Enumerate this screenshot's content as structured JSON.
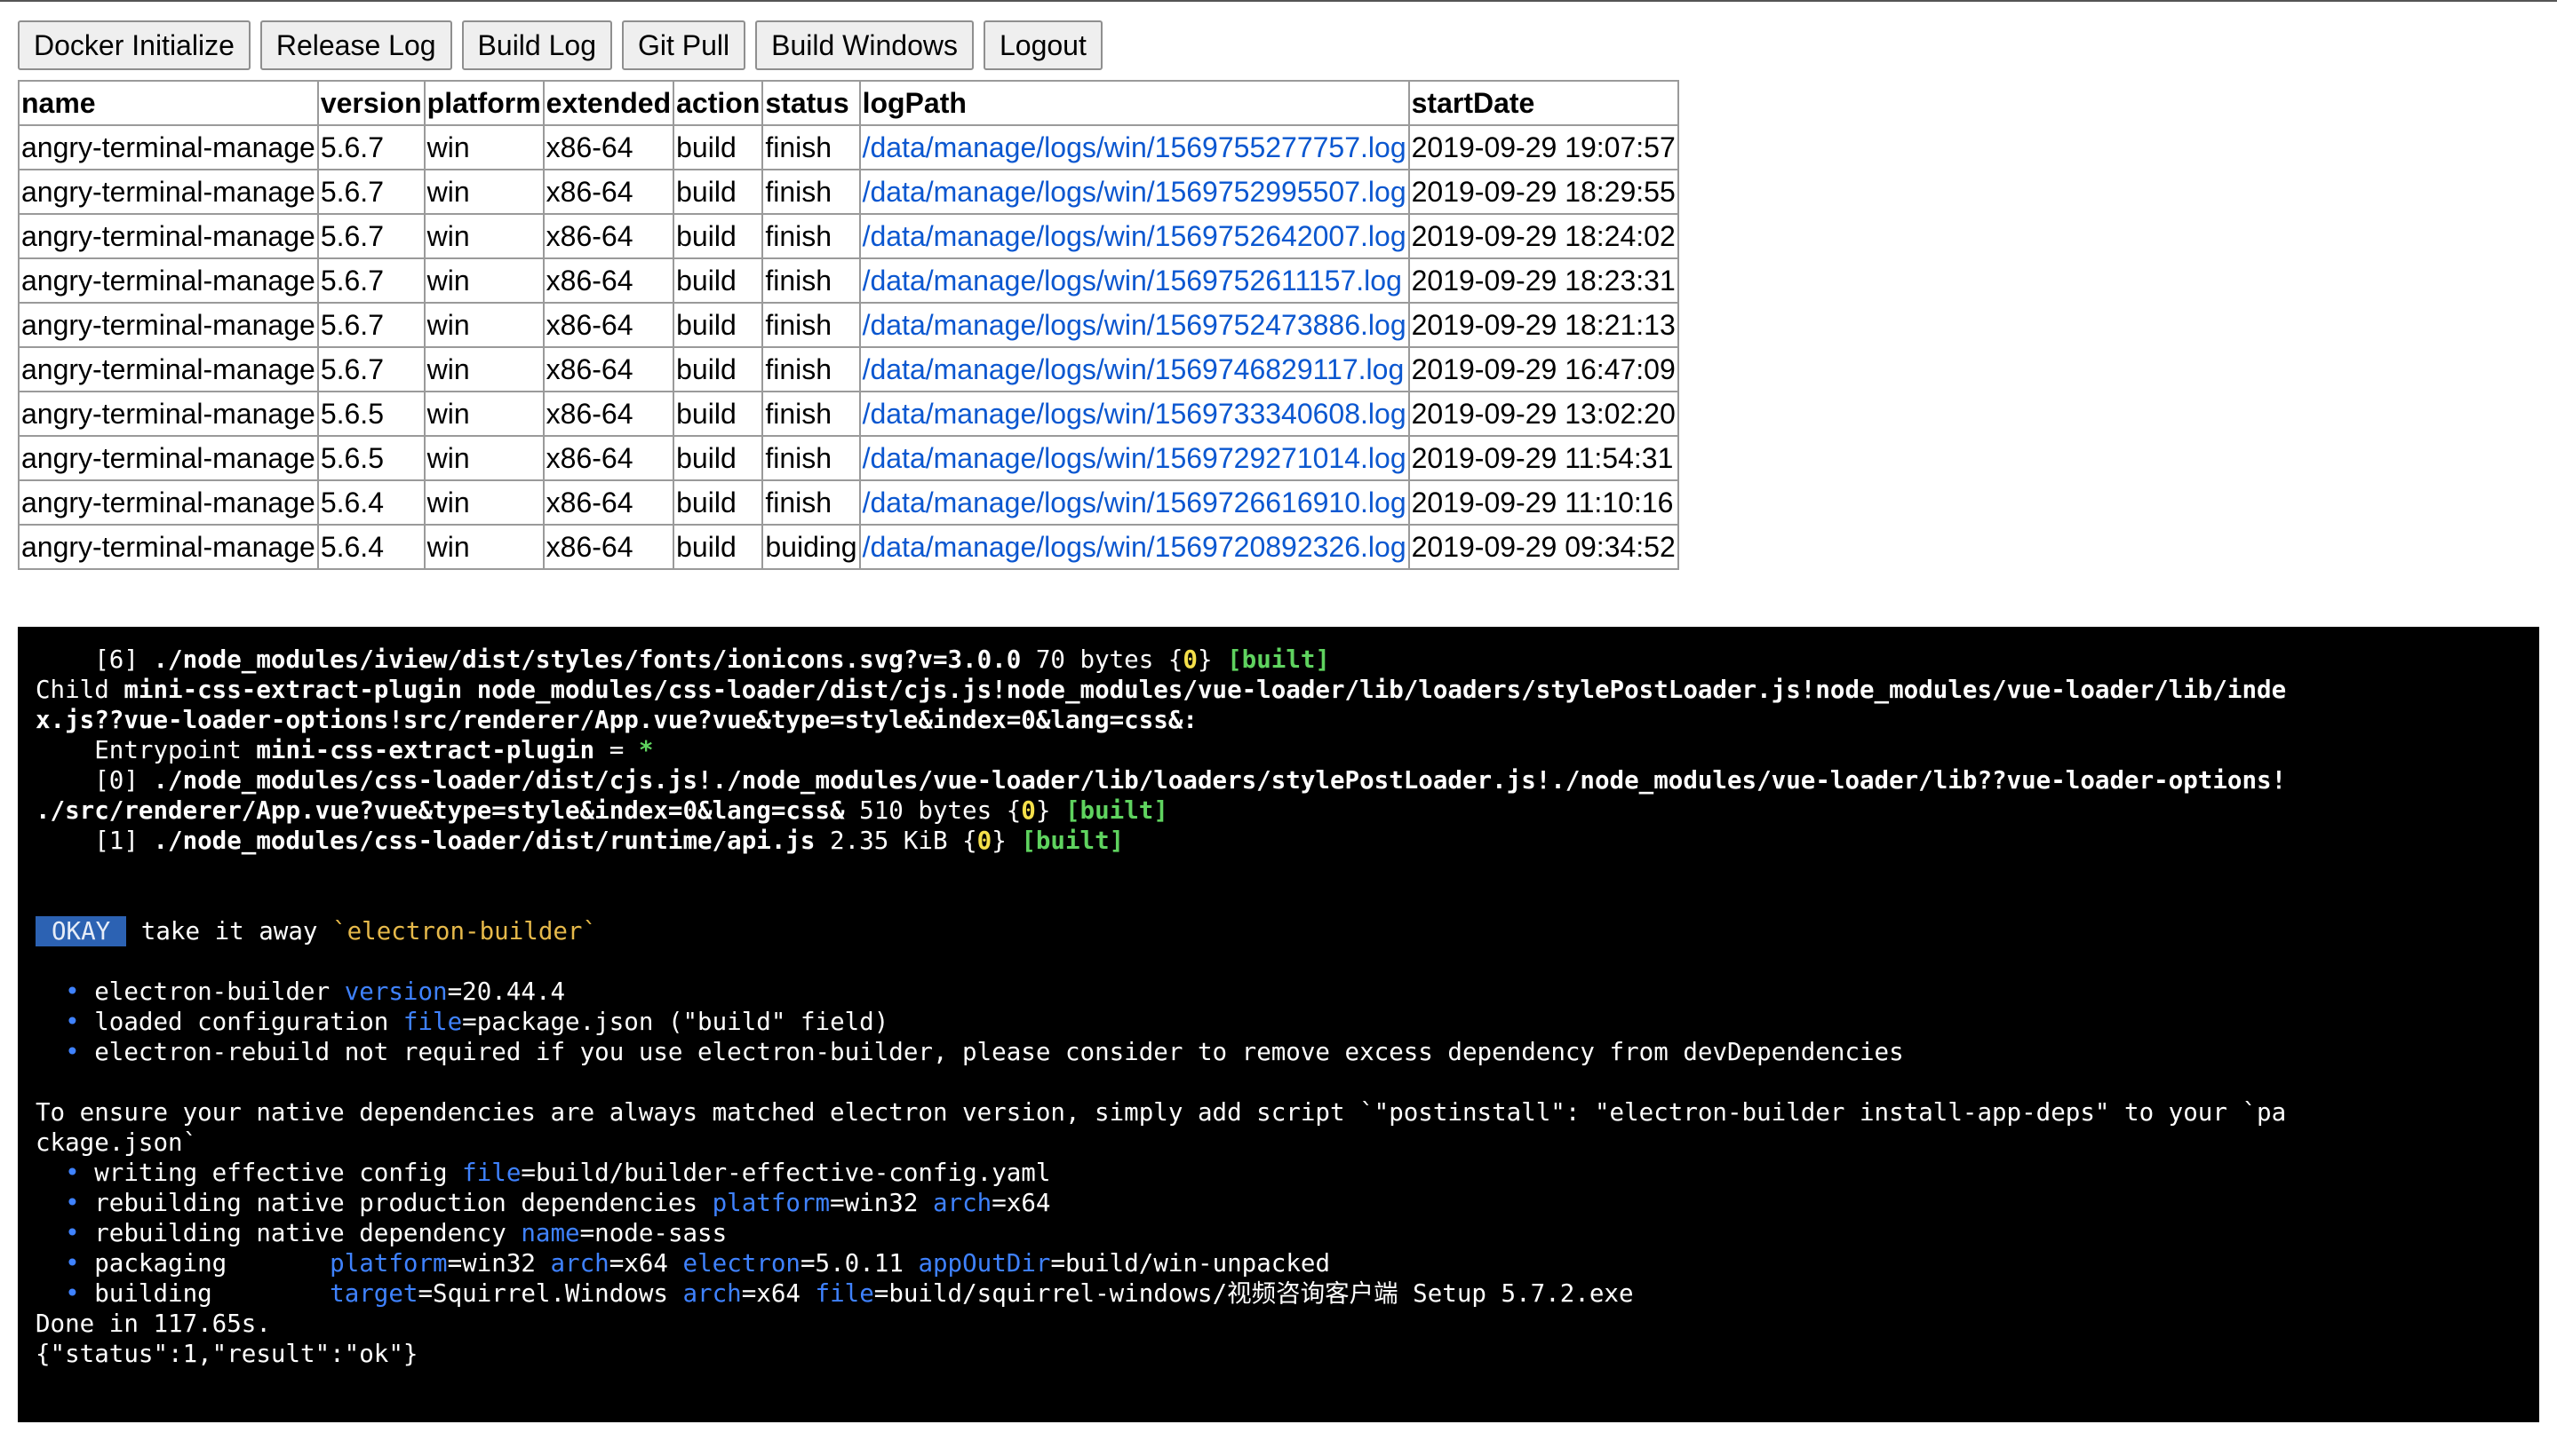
{
  "toolbar": {
    "buttons": [
      {
        "label": "Docker Initialize"
      },
      {
        "label": "Release Log"
      },
      {
        "label": "Build Log"
      },
      {
        "label": "Git Pull"
      },
      {
        "label": "Build Windows"
      },
      {
        "label": "Logout"
      }
    ]
  },
  "table": {
    "headers": [
      "name",
      "version",
      "platform",
      "extended",
      "action",
      "status",
      "logPath",
      "startDate"
    ],
    "rows": [
      {
        "name": "angry-terminal-manage",
        "version": "5.6.7",
        "platform": "win",
        "extended": "x86-64",
        "action": "build",
        "status": "finish",
        "logPath": "/data/manage/logs/win/1569755277757.log",
        "startDate": "2019-09-29 19:07:57"
      },
      {
        "name": "angry-terminal-manage",
        "version": "5.6.7",
        "platform": "win",
        "extended": "x86-64",
        "action": "build",
        "status": "finish",
        "logPath": "/data/manage/logs/win/1569752995507.log",
        "startDate": "2019-09-29 18:29:55"
      },
      {
        "name": "angry-terminal-manage",
        "version": "5.6.7",
        "platform": "win",
        "extended": "x86-64",
        "action": "build",
        "status": "finish",
        "logPath": "/data/manage/logs/win/1569752642007.log",
        "startDate": "2019-09-29 18:24:02"
      },
      {
        "name": "angry-terminal-manage",
        "version": "5.6.7",
        "platform": "win",
        "extended": "x86-64",
        "action": "build",
        "status": "finish",
        "logPath": "/data/manage/logs/win/1569752611157.log",
        "startDate": "2019-09-29 18:23:31"
      },
      {
        "name": "angry-terminal-manage",
        "version": "5.6.7",
        "platform": "win",
        "extended": "x86-64",
        "action": "build",
        "status": "finish",
        "logPath": "/data/manage/logs/win/1569752473886.log",
        "startDate": "2019-09-29 18:21:13"
      },
      {
        "name": "angry-terminal-manage",
        "version": "5.6.7",
        "platform": "win",
        "extended": "x86-64",
        "action": "build",
        "status": "finish",
        "logPath": "/data/manage/logs/win/1569746829117.log",
        "startDate": "2019-09-29 16:47:09"
      },
      {
        "name": "angry-terminal-manage",
        "version": "5.6.5",
        "platform": "win",
        "extended": "x86-64",
        "action": "build",
        "status": "finish",
        "logPath": "/data/manage/logs/win/1569733340608.log",
        "startDate": "2019-09-29 13:02:20"
      },
      {
        "name": "angry-terminal-manage",
        "version": "5.6.5",
        "platform": "win",
        "extended": "x86-64",
        "action": "build",
        "status": "finish",
        "logPath": "/data/manage/logs/win/1569729271014.log",
        "startDate": "2019-09-29 11:54:31"
      },
      {
        "name": "angry-terminal-manage",
        "version": "5.6.4",
        "platform": "win",
        "extended": "x86-64",
        "action": "build",
        "status": "finish",
        "logPath": "/data/manage/logs/win/1569726616910.log",
        "startDate": "2019-09-29 11:10:16"
      },
      {
        "name": "angry-terminal-manage",
        "version": "5.6.4",
        "platform": "win",
        "extended": "x86-64",
        "action": "build",
        "status": "buiding",
        "logPath": "/data/manage/logs/win/1569720892326.log",
        "startDate": "2019-09-29 09:34:52"
      }
    ]
  },
  "terminal": {
    "lines": [
      [
        {
          "t": "    [6] ",
          "c": ""
        },
        {
          "t": "./node_modules/iview/dist/styles/fonts/ionicons.svg?v=3.0.0",
          "c": "b"
        },
        {
          "t": " 70 bytes {",
          "c": ""
        },
        {
          "t": "0",
          "c": "y"
        },
        {
          "t": "} ",
          "c": ""
        },
        {
          "t": "[built]",
          "c": "g"
        }
      ],
      [
        {
          "t": "Child ",
          "c": ""
        },
        {
          "t": "mini-css-extract-plugin node_modules/css-loader/dist/cjs.js!node_modules/vue-loader/lib/loaders/stylePostLoader.js!node_modules/vue-loader/lib/inde",
          "c": "b"
        }
      ],
      [
        {
          "t": "x.js??vue-loader-options!src/renderer/App.vue?vue&type=style&index=0&lang=css&:",
          "c": "b"
        }
      ],
      [
        {
          "t": "    Entrypoint ",
          "c": ""
        },
        {
          "t": "mini-css-extract-plugin",
          "c": "b"
        },
        {
          "t": " = ",
          "c": ""
        },
        {
          "t": "*",
          "c": "g"
        }
      ],
      [
        {
          "t": "    [0] ",
          "c": ""
        },
        {
          "t": "./node_modules/css-loader/dist/cjs.js!./node_modules/vue-loader/lib/loaders/stylePostLoader.js!./node_modules/vue-loader/lib??vue-loader-options!",
          "c": "b"
        }
      ],
      [
        {
          "t": "./src/renderer/App.vue?vue&type=style&index=0&lang=css&",
          "c": "b"
        },
        {
          "t": " 510 bytes {",
          "c": ""
        },
        {
          "t": "0",
          "c": "y"
        },
        {
          "t": "} ",
          "c": ""
        },
        {
          "t": "[built]",
          "c": "g"
        }
      ],
      [
        {
          "t": "    [1] ",
          "c": ""
        },
        {
          "t": "./node_modules/css-loader/dist/runtime/api.js",
          "c": "b"
        },
        {
          "t": " 2.35 KiB {",
          "c": ""
        },
        {
          "t": "0",
          "c": "y"
        },
        {
          "t": "} ",
          "c": ""
        },
        {
          "t": "[built]",
          "c": "g"
        }
      ],
      [],
      [],
      [
        {
          "t": "OKAY",
          "c": "badge"
        },
        {
          "t": " take it away ",
          "c": ""
        },
        {
          "t": "`electron-builder`",
          "c": "or"
        }
      ],
      [],
      [
        {
          "t": "  • ",
          "c": "bl"
        },
        {
          "t": "electron-builder ",
          "c": ""
        },
        {
          "t": "version",
          "c": "bl"
        },
        {
          "t": "=20.44.4",
          "c": ""
        }
      ],
      [
        {
          "t": "  • ",
          "c": "bl"
        },
        {
          "t": "loaded configuration ",
          "c": ""
        },
        {
          "t": "file",
          "c": "bl"
        },
        {
          "t": "=package.json (\"build\" field)",
          "c": ""
        }
      ],
      [
        {
          "t": "  • ",
          "c": "bl"
        },
        {
          "t": "electron-rebuild not required if you use electron-builder, please consider to remove excess dependency from devDependencies",
          "c": ""
        }
      ],
      [],
      [
        {
          "t": "To ensure your native dependencies are always matched electron version, simply add script `\"postinstall\": \"electron-builder install-app-deps\" to your `pa",
          "c": ""
        }
      ],
      [
        {
          "t": "ckage.json`",
          "c": ""
        }
      ],
      [
        {
          "t": "  • ",
          "c": "bl"
        },
        {
          "t": "writing effective config ",
          "c": ""
        },
        {
          "t": "file",
          "c": "bl"
        },
        {
          "t": "=build/builder-effective-config.yaml",
          "c": ""
        }
      ],
      [
        {
          "t": "  • ",
          "c": "bl"
        },
        {
          "t": "rebuilding native production dependencies ",
          "c": ""
        },
        {
          "t": "platform",
          "c": "bl"
        },
        {
          "t": "=win32 ",
          "c": ""
        },
        {
          "t": "arch",
          "c": "bl"
        },
        {
          "t": "=x64",
          "c": ""
        }
      ],
      [
        {
          "t": "  • ",
          "c": "bl"
        },
        {
          "t": "rebuilding native dependency ",
          "c": ""
        },
        {
          "t": "name",
          "c": "bl"
        },
        {
          "t": "=node-sass",
          "c": ""
        }
      ],
      [
        {
          "t": "  • ",
          "c": "bl"
        },
        {
          "t": "packaging       ",
          "c": ""
        },
        {
          "t": "platform",
          "c": "bl"
        },
        {
          "t": "=win32 ",
          "c": ""
        },
        {
          "t": "arch",
          "c": "bl"
        },
        {
          "t": "=x64 ",
          "c": ""
        },
        {
          "t": "electron",
          "c": "bl"
        },
        {
          "t": "=5.0.11 ",
          "c": ""
        },
        {
          "t": "appOutDir",
          "c": "bl"
        },
        {
          "t": "=build/win-unpacked",
          "c": ""
        }
      ],
      [
        {
          "t": "  • ",
          "c": "bl"
        },
        {
          "t": "building        ",
          "c": ""
        },
        {
          "t": "target",
          "c": "bl"
        },
        {
          "t": "=Squirrel.Windows ",
          "c": ""
        },
        {
          "t": "arch",
          "c": "bl"
        },
        {
          "t": "=x64 ",
          "c": ""
        },
        {
          "t": "file",
          "c": "bl"
        },
        {
          "t": "=build/squirrel-windows/视频咨询客户端 Setup 5.7.2.exe",
          "c": ""
        }
      ],
      [
        {
          "t": "Done in 117.65s.",
          "c": ""
        }
      ],
      [
        {
          "t": "{\"status\":1,\"result\":\"ok\"}",
          "c": ""
        }
      ]
    ]
  }
}
